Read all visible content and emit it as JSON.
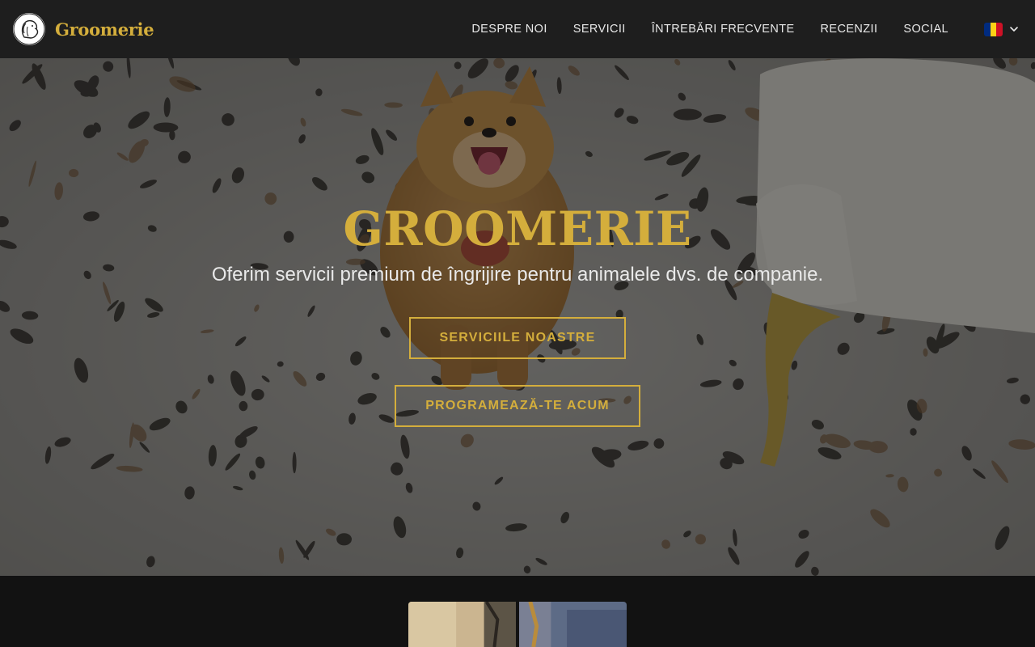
{
  "navbar": {
    "brand_name": "Groomerie",
    "links": [
      {
        "label": "DESPRE NOI"
      },
      {
        "label": "SERVICII"
      },
      {
        "label": "ÎNTREBĂRI FRECVENTE"
      },
      {
        "label": "RECENZII"
      },
      {
        "label": "SOCIAL"
      }
    ],
    "language": {
      "flag_icon": "romania-flag-icon",
      "flag_colors": [
        "#002B7F",
        "#FCD116",
        "#CE1126"
      ]
    }
  },
  "hero": {
    "title": "GROOMERIE",
    "subtitle": "Oferim servicii premium de îngrijire pentru animalele dvs. de companie.",
    "primary_button": "SERVICIILE NOASTRE",
    "secondary_button": "PROGRAMEAZĂ-TE ACUM"
  },
  "colors": {
    "accent": "#d4ae3c",
    "navbar_bg": "#1e1e1e",
    "page_bg": "#121212"
  }
}
